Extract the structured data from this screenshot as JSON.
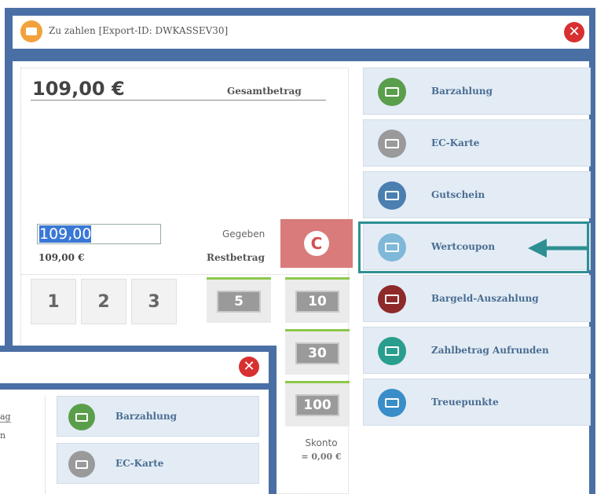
{
  "window": {
    "title": "Zu zahlen [Export-ID: DWKASSEV30]",
    "close_glyph": "✕"
  },
  "summary": {
    "total_amount": "109,00 €",
    "total_label": "Gesamtbetrag",
    "given_value": "109,00",
    "given_label": "Gegeben",
    "rest_amount": "109,00 €",
    "rest_label": "Restbetrag",
    "clear_label": "C"
  },
  "keypad": {
    "keys": [
      "1",
      "2",
      "3"
    ]
  },
  "bills": [
    "5",
    "10",
    "30",
    "100"
  ],
  "skonto": {
    "label": "Skonto",
    "value": "= 0,00 €"
  },
  "payment_methods": [
    {
      "label": "Barzahlung",
      "icon": "cash-register-icon",
      "color": "#5a9e4b"
    },
    {
      "label": "EC-Karte",
      "icon": "card-icon",
      "color": "#9a9a9a"
    },
    {
      "label": "Gutschein",
      "icon": "voucher-icon",
      "color": "#4a7fb0"
    },
    {
      "label": "Wertcoupon",
      "icon": "coupon-icon",
      "color": "#7fb8d8"
    },
    {
      "label": "Bargeld-Auszahlung",
      "icon": "cash-out-icon",
      "color": "#8e2a2a"
    },
    {
      "label": "Zahlbetrag Aufrunden",
      "icon": "round-up-icon",
      "color": "#2a9e8e"
    },
    {
      "label": "Treuepunkte",
      "icon": "loyalty-icon",
      "color": "#3a8ec8"
    }
  ],
  "highlighted_method": "Wertcoupon",
  "overlay": {
    "close_glyph": "✕",
    "left_labels": [
      "ag",
      "n"
    ],
    "methods": [
      {
        "label": "Barzahlung",
        "icon": "cash-register-icon",
        "color": "#5a9e4b"
      },
      {
        "label": "EC-Karte",
        "icon": "card-icon",
        "color": "#9a9a9a"
      }
    ]
  },
  "colors": {
    "frame": "#4a6fa5",
    "accent_highlight": "#2e8f92",
    "clear_button": "#d97b7b"
  }
}
